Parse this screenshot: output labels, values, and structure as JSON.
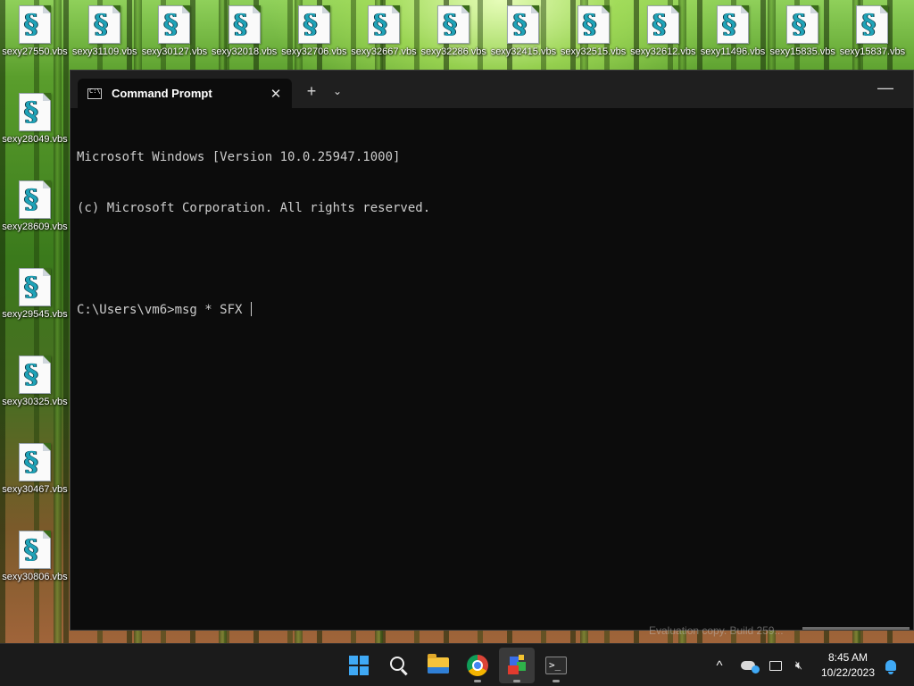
{
  "desktop": {
    "top_row": [
      "sexy27550.vbs",
      "sexy31109.vbs",
      "sexy30127.vbs",
      "sexy32018.vbs",
      "sexy32706.vbs",
      "sexy32667.vbs",
      "sexy32286.vbs",
      "sexy32415.vbs",
      "sexy32515.vbs",
      "sexy32612.vbs",
      "sexy11496.vbs",
      "sexy15835.vbs",
      "sexy15837.vbs"
    ],
    "left_column": [
      "sexy28049.vbs",
      "sexy28609.vbs",
      "sexy29545.vbs",
      "sexy30325.vbs",
      "sexy30467.vbs",
      "sexy30806.vbs"
    ],
    "icon_glyph": "script-file-icon"
  },
  "terminal": {
    "tab_title": "Command Prompt",
    "tab_close": "✕",
    "new_tab": "+",
    "dropdown": "⌄",
    "minimize": "—",
    "lines": [
      "Microsoft Windows [Version 10.0.25947.1000]",
      "(c) Microsoft Corporation. All rights reserved.",
      "",
      "C:\\Users\\vm6>msg * SFX "
    ],
    "watermark": "Evaluation copy. Build 259..."
  },
  "taskbar": {
    "apps": [
      "start-icon",
      "search-icon",
      "file-explorer-icon",
      "chrome-icon",
      "app-blocks-icon",
      "terminal-icon"
    ],
    "tray": {
      "chevron": "^",
      "time": "8:45 AM",
      "date": "10/22/2023"
    }
  },
  "colors": {
    "terminal_bg": "#0c0c0c",
    "titlebar_bg": "#1f1f1f",
    "taskbar_bg": "#1b1b1b",
    "accent": "#3fa9f5"
  }
}
